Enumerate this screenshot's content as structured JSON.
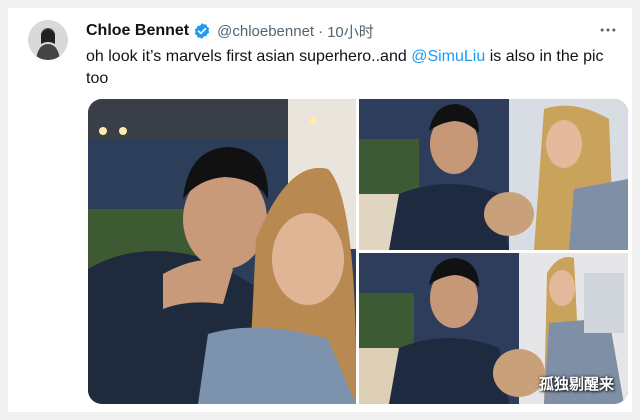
{
  "tweet": {
    "author_name": "Chloe Bennet",
    "author_handle": "@chloebennet",
    "separator": "·",
    "timestamp": "10小时",
    "text_part1": "oh look it’s marvels first asian superhero..and ",
    "mention": "@SimuLiu",
    "text_part2": " is also in the pic too",
    "more_icon": "more-horizontal-icon",
    "verified_icon": "verified-badge-icon"
  },
  "media": {
    "photo_count": 3
  },
  "watermark": "孤独剔醒来",
  "colors": {
    "text": "#0f1419",
    "secondary": "#536471",
    "link": "#1d9bf0",
    "verified": "#1d9bf0"
  }
}
